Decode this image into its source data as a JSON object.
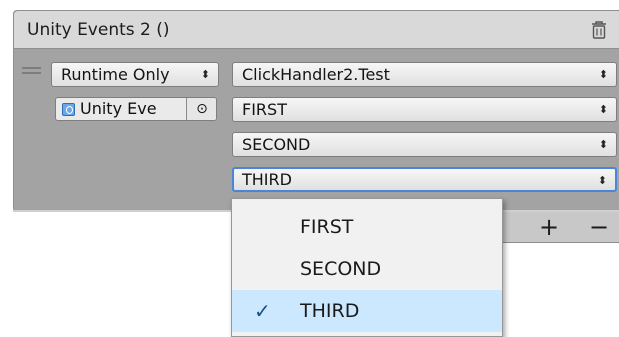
{
  "header": {
    "title": "Unity Events 2 ()",
    "delete_icon": "trash-icon"
  },
  "listener": {
    "drag_handle_icon": "drag-handle-icon",
    "runtime_dropdown": "Runtime Only",
    "method_dropdown": "ClickHandler2.Test",
    "object_field": {
      "label": "Unity Eve",
      "icon": "gameobject-icon",
      "picker_glyph": "⊙"
    },
    "args": [
      "FIRST",
      "SECOND",
      "THIRD"
    ],
    "arrow_glyph": "⬍"
  },
  "footer": {
    "add_label": "+",
    "remove_label": "−"
  },
  "popup": {
    "options": [
      "FIRST",
      "SECOND",
      "THIRD"
    ],
    "selected": "THIRD",
    "check_glyph": "✓"
  }
}
